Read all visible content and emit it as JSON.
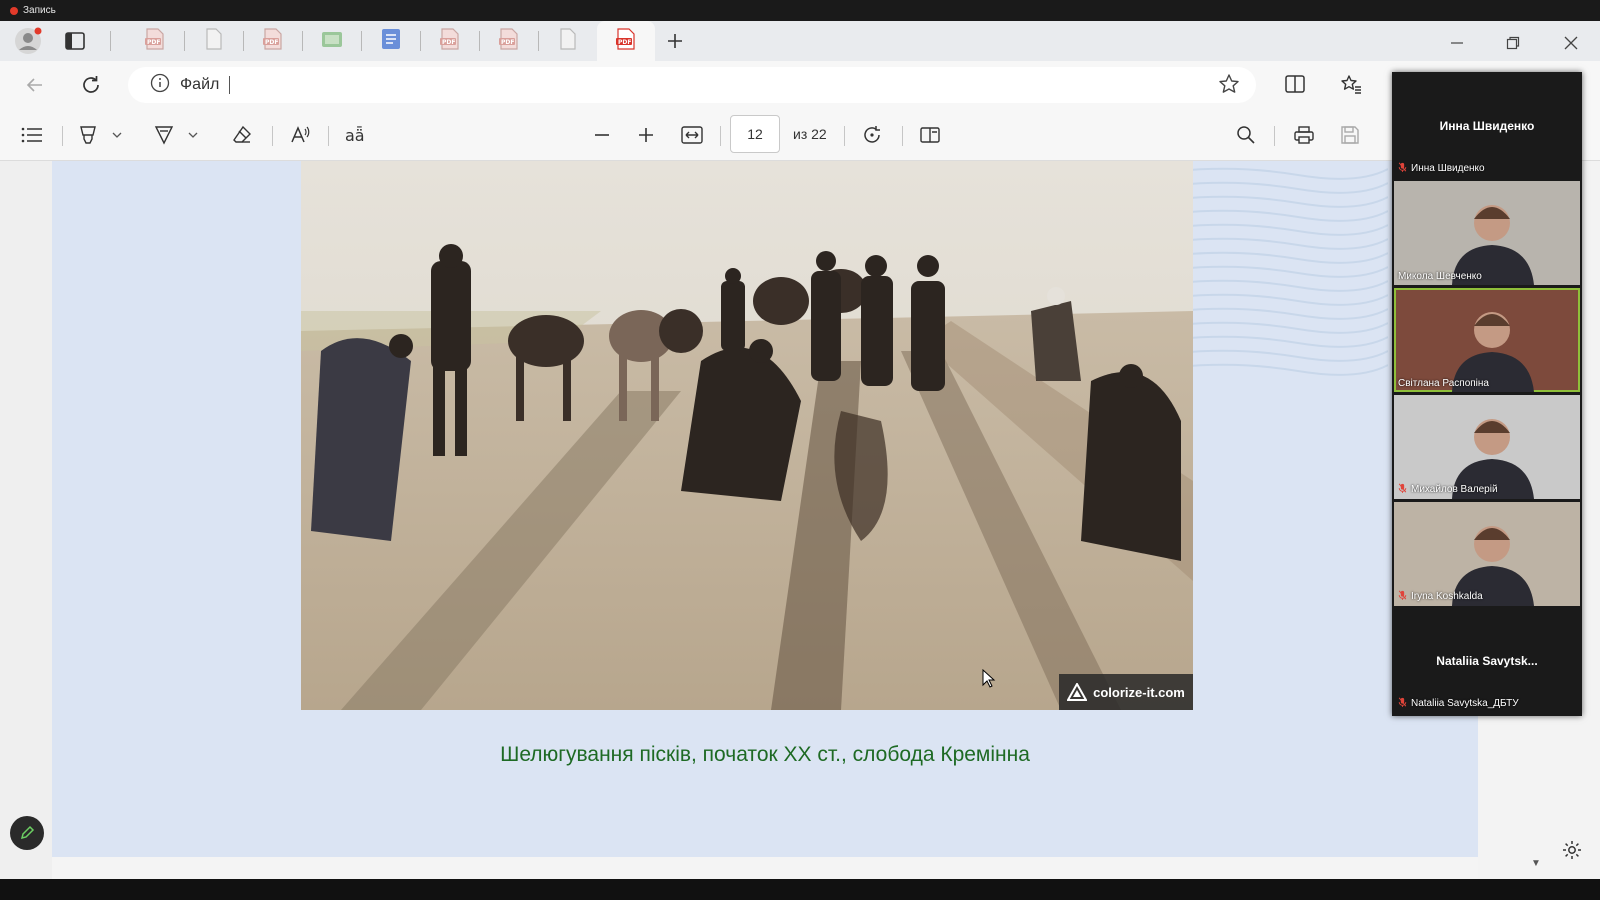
{
  "recording": {
    "label": "Запись"
  },
  "tabs": [
    {
      "icon": "pdf-icon",
      "active": false
    },
    {
      "icon": "document-icon",
      "active": false
    },
    {
      "icon": "pdf-icon",
      "active": false
    },
    {
      "icon": "image-icon",
      "active": false
    },
    {
      "icon": "docs-icon",
      "active": false
    },
    {
      "icon": "pdf-icon",
      "active": false
    },
    {
      "icon": "pdf-icon",
      "active": false
    },
    {
      "icon": "document-icon",
      "active": false
    },
    {
      "icon": "pdf-icon",
      "active": true
    }
  ],
  "address": {
    "scheme_label": "Файл",
    "url": ""
  },
  "pdf_toolbar": {
    "page_current": "12",
    "page_total_label": "из 22"
  },
  "slide": {
    "watermark": "colorize-it.com",
    "caption": "Шелюгування пісків,  початок XX ст., слобода Кремінна"
  },
  "participants": [
    {
      "display": "Инна Швиденко",
      "label": "Инна Швиденко",
      "camera": false,
      "muted": true
    },
    {
      "label": "Микола Шевченко",
      "camera": true,
      "muted": false,
      "bg": "#b8b4ad"
    },
    {
      "label": "Світлана Распопіна",
      "camera": true,
      "muted": false,
      "bg": "#7d4a3c",
      "active": true
    },
    {
      "label": "Михайлов Валерій",
      "camera": true,
      "muted": true,
      "bg": "#c9c9c9"
    },
    {
      "label": "Iryna Koshkalda",
      "camera": true,
      "muted": true,
      "bg": "#bdb3a5"
    },
    {
      "display": "Nataliia  Savytsk...",
      "label": "Nataliia Savytska_ДБТУ",
      "camera": false,
      "muted": true
    }
  ],
  "colors": {
    "caption": "#1e6a24",
    "slide_bg": "#dbe4f3",
    "accent_pdf": "#d9342b"
  }
}
